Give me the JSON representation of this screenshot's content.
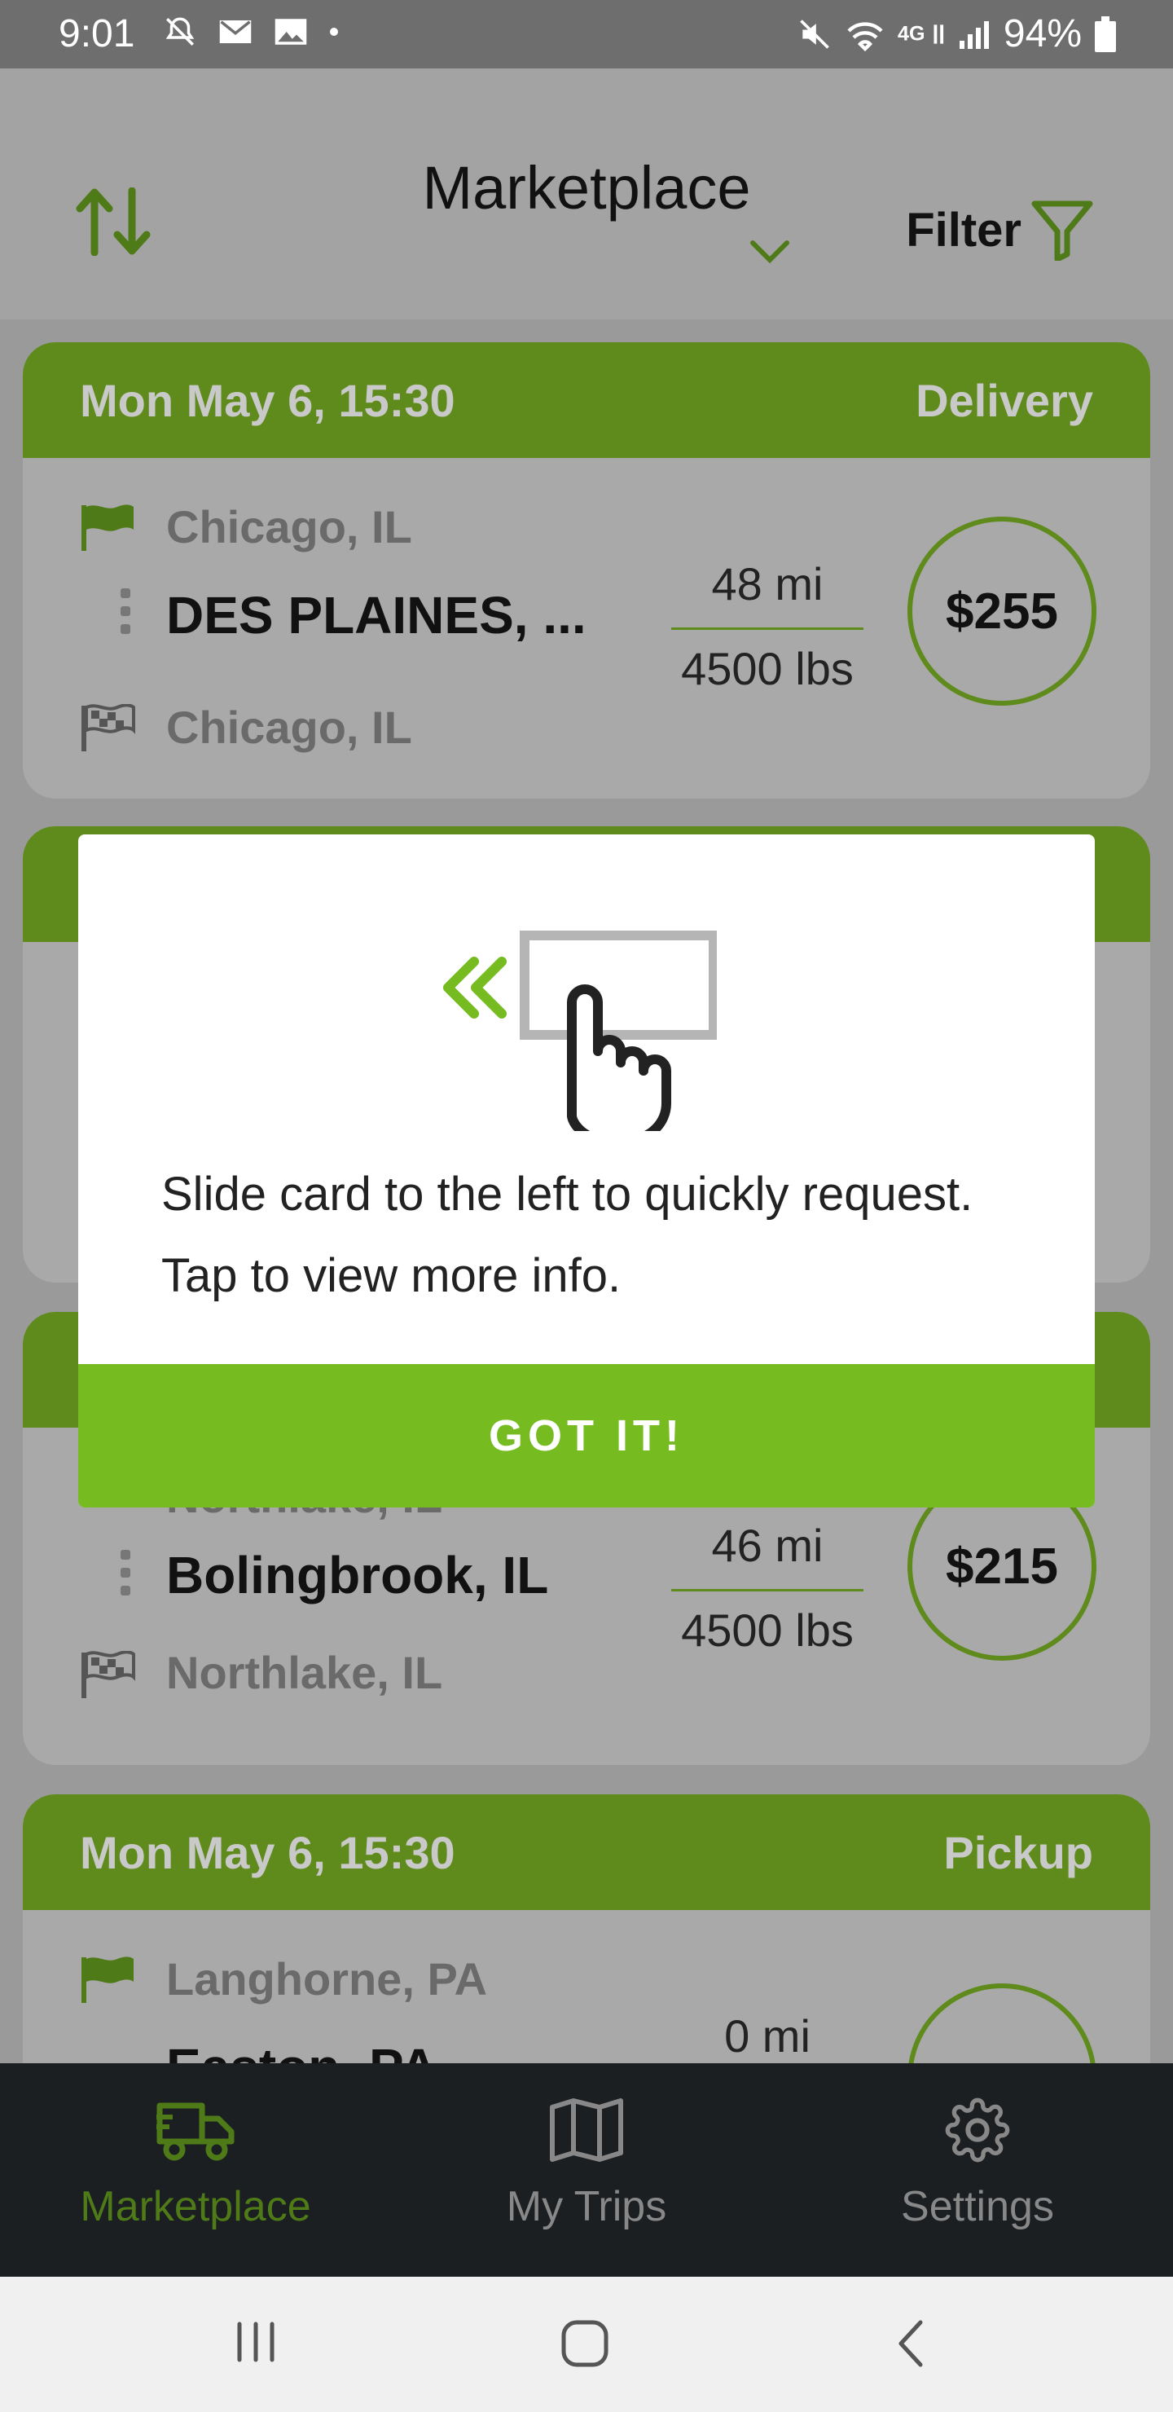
{
  "status": {
    "time": "9:01",
    "battery": "94%"
  },
  "header": {
    "title": "Marketplace",
    "filter_label": "Filter"
  },
  "cards": [
    {
      "date": "Mon May 6, 15:30",
      "type": "Delivery",
      "origin": "Chicago, IL",
      "main": "DES PLAINES, ...",
      "destination": "Chicago, IL",
      "distance": "48 mi",
      "weight": "4500 lbs",
      "price": "$255"
    },
    {
      "origin": "Northlake, IL",
      "main": "Bolingbrook, IL",
      "destination": "Northlake, IL",
      "distance": "46 mi",
      "weight": "4500 lbs",
      "price": "$215"
    },
    {
      "date": "Mon May 6, 15:30",
      "type": "Pickup",
      "origin": "Langhorne, PA",
      "main": "Easton, PA",
      "distance": "0 mi"
    }
  ],
  "modal": {
    "line1": "Slide card to the left to quickly request.",
    "line2": "Tap to view more info.",
    "button": "GOT IT!"
  },
  "nav": {
    "marketplace": "Marketplace",
    "trips": "My Trips",
    "settings": "Settings"
  },
  "colors": {
    "brand_green": "#76bc21",
    "dim_green": "#5f8a1c",
    "nav_bg": "#1b1f22"
  }
}
